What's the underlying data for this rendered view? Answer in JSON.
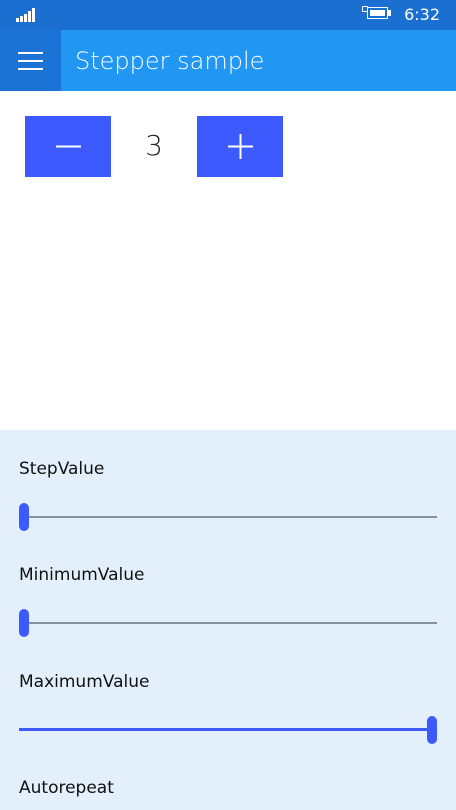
{
  "status_bar": {
    "time": "6:32",
    "signal_icon": "signal-strength-icon",
    "battery_icon": "battery-charging-icon"
  },
  "header": {
    "title": "Stepper sample",
    "menu_icon": "hamburger-menu-icon",
    "background_color": "#2196f3"
  },
  "stepper": {
    "value": "3",
    "minus_icon": "minus-icon",
    "plus_icon": "plus-icon",
    "button_color": "#3d5afe"
  },
  "settings": {
    "step_value": {
      "label": "StepValue",
      "level": 0
    },
    "minimum_value": {
      "label": "MinimumValue",
      "level": 0
    },
    "maximum_value": {
      "label": "MaximumValue",
      "level": 1
    },
    "autorepeat": {
      "label": "Autorepeat"
    }
  }
}
